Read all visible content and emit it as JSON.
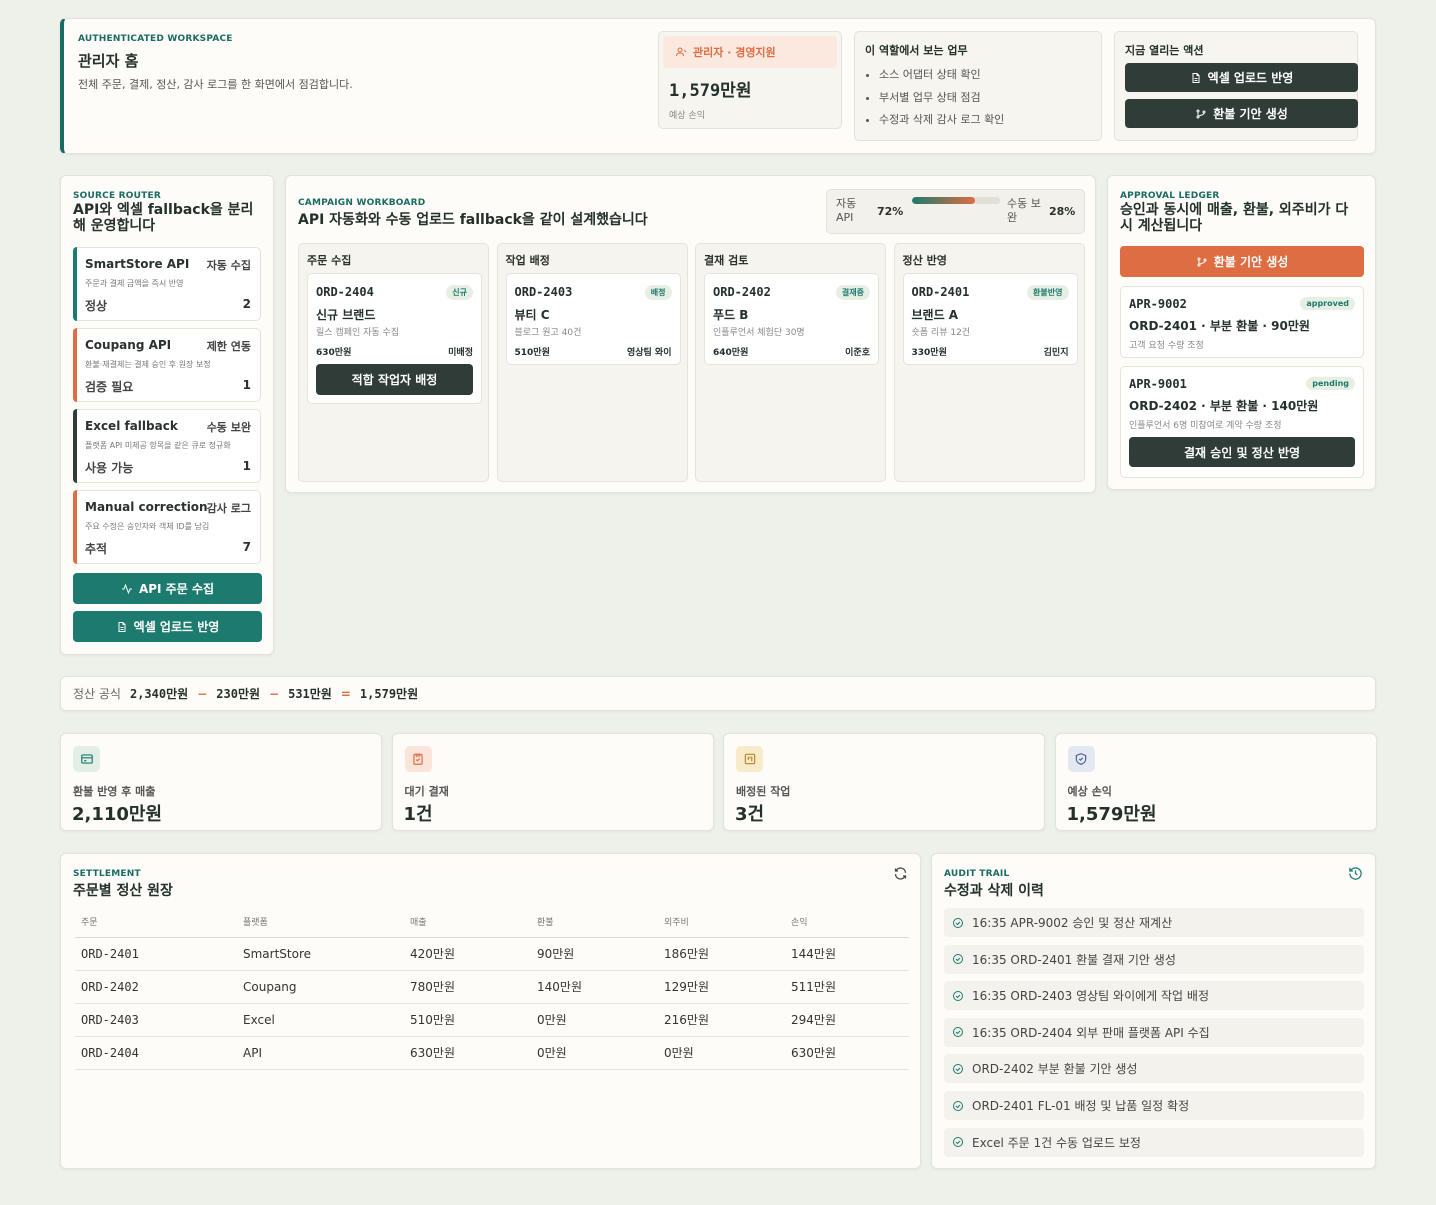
{
  "header": {
    "eyebrow": "AUTHENTICATED WORKSPACE",
    "title": "관리자 홈",
    "subtitle": "전체 주문, 결제, 정산, 감사 로그를 한 화면에서 점검합니다.",
    "role_label": "관리자 · 경영지원",
    "loss_value": "1,579만원",
    "loss_label": "예상 손익",
    "tasks_title": "이 역할에서 보는 업무",
    "tasks": [
      "소스 어댑터 상태 확인",
      "부서별 업무 상태 점검",
      "수정과 삭제 감사 로그 확인"
    ],
    "actions_title": "지금 열리는 액션",
    "action_excel": "엑셀 업로드 반영",
    "action_refund": "환불 기안 생성"
  },
  "source_router": {
    "eyebrow": "SOURCE ROUTER",
    "title": "API와 엑셀 fallback을 분리해 운영합니다",
    "sources": [
      {
        "name": "SmartStore API",
        "mode": "자동 수집",
        "desc": "주문과 결제 금액을 즉시 반영",
        "status": "정상",
        "count": "2",
        "color": "#1c7a6e"
      },
      {
        "name": "Coupang API",
        "mode": "제한 연동",
        "desc": "환불·재결제는 결제 승인 후 원장 보정",
        "status": "검증 필요",
        "count": "1",
        "color": "#df6d42"
      },
      {
        "name": "Excel fallback",
        "mode": "수동 보완",
        "desc": "플랫폼 API 미제공 항목을 같은 큐로 정규화",
        "status": "사용 가능",
        "count": "1",
        "color": "#2f3c37"
      },
      {
        "name": "Manual correction",
        "mode": "감사 로그",
        "desc": "주요 수정은 승인자와 객체 ID를 남김",
        "status": "추적",
        "count": "7",
        "color": "#df6d42"
      }
    ],
    "btn_api": "API 주문 수집",
    "btn_excel": "엑셀 업로드 반영"
  },
  "workboard": {
    "eyebrow": "CAMPAIGN WORKBOARD",
    "title": "API 자동화와 수동 업로드 fallback을 같이 설계했습니다",
    "auto_label": "자동 API",
    "auto_pct": "72%",
    "manual_label": "수동 보완",
    "manual_pct": "28%",
    "auto_fraction": 0.72,
    "columns": [
      {
        "title": "주문 수집",
        "order": "ORD-2404",
        "tag": "신규",
        "brand": "신규 브랜드",
        "desc": "릴스 캠페인 자동 수집",
        "amount": "630만원",
        "assignee": "미배정",
        "button": "적합 작업자 배정"
      },
      {
        "title": "작업 배정",
        "order": "ORD-2403",
        "tag": "배정",
        "brand": "뷰티 C",
        "desc": "블로그 원고 40건",
        "amount": "510만원",
        "assignee": "영상팀 와이"
      },
      {
        "title": "결재 검토",
        "order": "ORD-2402",
        "tag": "결재중",
        "brand": "푸드 B",
        "desc": "인플루언서 체험단 30명",
        "amount": "640만원",
        "assignee": "이준호"
      },
      {
        "title": "정산 반영",
        "order": "ORD-2401",
        "tag": "환불반영",
        "brand": "브랜드 A",
        "desc": "숏폼 리뷰 12건",
        "amount": "330만원",
        "assignee": "김민지"
      }
    ]
  },
  "approval": {
    "eyebrow": "APPROVAL LEDGER",
    "title": "승인과 동시에 매출, 환불, 외주비가 다시 계산됩니다",
    "btn_refund": "환불 기안 생성",
    "items": [
      {
        "id": "APR-9002",
        "status": "approved",
        "title": "ORD-2401 · 부분 환불 · 90만원",
        "desc": "고객 요청 수량 조정"
      },
      {
        "id": "APR-9001",
        "status": "pending",
        "title": "ORD-2402 · 부분 환불 · 140만원",
        "desc": "인플루언서 6명 미참여로 계약 수량 조정"
      }
    ],
    "btn_approve": "결재 승인 및 정산 반영"
  },
  "formula": {
    "label": "정산 공식",
    "a": "2,340만원",
    "minus1": "−",
    "b": "230만원",
    "minus2": "−",
    "c": "531만원",
    "eq": "=",
    "result": "1,579만원"
  },
  "kpis": [
    {
      "label": "환불 반영 후 매출",
      "value": "2,110만원",
      "icon": "wallet-icon",
      "bg": "#e3efe6",
      "fg": "#1c7a6e"
    },
    {
      "label": "대기 결재",
      "value": "1건",
      "icon": "clipboard-check-icon",
      "bg": "#fbe4da",
      "fg": "#df6d42"
    },
    {
      "label": "배정된 작업",
      "value": "3건",
      "icon": "kanban-icon",
      "bg": "#f7ebc9",
      "fg": "#b7862a"
    },
    {
      "label": "예상 손익",
      "value": "1,579만원",
      "icon": "shield-check-icon",
      "bg": "#e3e8f3",
      "fg": "#4a5f8d"
    }
  ],
  "settlement": {
    "eyebrow": "SETTLEMENT",
    "title": "주문별 정산 원장",
    "headers": [
      "주문",
      "플랫폼",
      "매출",
      "환불",
      "외주비",
      "손익"
    ],
    "rows": [
      [
        "ORD-2401",
        "SmartStore",
        "420만원",
        "90만원",
        "186만원",
        "144만원"
      ],
      [
        "ORD-2402",
        "Coupang",
        "780만원",
        "140만원",
        "129만원",
        "511만원"
      ],
      [
        "ORD-2403",
        "Excel",
        "510만원",
        "0만원",
        "216만원",
        "294만원"
      ],
      [
        "ORD-2404",
        "API",
        "630만원",
        "0만원",
        "0만원",
        "630만원"
      ]
    ]
  },
  "audit": {
    "eyebrow": "AUDIT TRAIL",
    "title": "수정과 삭제 이력",
    "items": [
      "16:35 APR-9002 승인 및 정산 재계산",
      "16:35 ORD-2401 환불 결재 기안 생성",
      "16:35 ORD-2403 영상팀 와이에게 작업 배정",
      "16:35 ORD-2404 외부 판매 플랫폼 API 수집",
      "ORD-2402 부분 환불 기안 생성",
      "ORD-2401 FL-01 배정 및 납품 일정 확정",
      "Excel 주문 1건 수동 업로드 보정"
    ]
  }
}
